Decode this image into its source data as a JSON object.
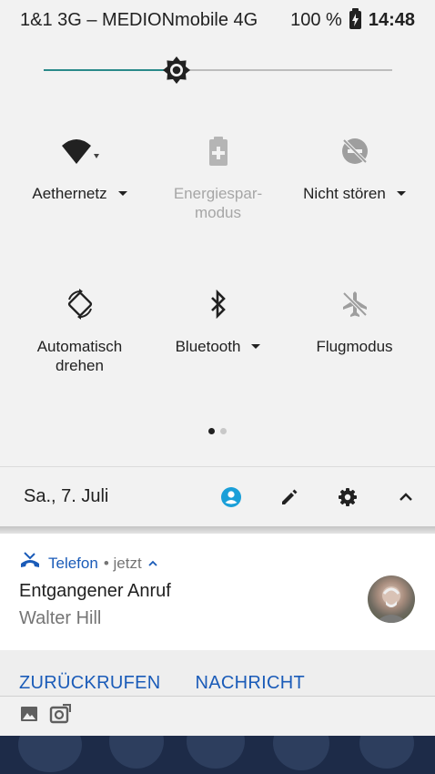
{
  "status_bar": {
    "carrier": "1&1 3G – MEDIONmobile 4G",
    "battery": "100 %",
    "time": "14:48"
  },
  "brightness": {
    "level_percent": 38
  },
  "quick_settings": [
    {
      "id": "wifi",
      "icon": "wifi-icon",
      "label": "Aethernetz",
      "dropdown": true,
      "enabled": true
    },
    {
      "id": "battery-saver",
      "icon": "battery-saver-icon",
      "label": "Energiespar-\nmodus",
      "dropdown": false,
      "enabled": false
    },
    {
      "id": "dnd",
      "icon": "do-not-disturb-icon",
      "label": "Nicht stören",
      "dropdown": true,
      "enabled": false
    },
    {
      "id": "autorotate",
      "icon": "rotate-icon",
      "label": "Automatisch\ndrehen",
      "dropdown": false,
      "enabled": true
    },
    {
      "id": "bluetooth",
      "icon": "bluetooth-icon",
      "label": "Bluetooth",
      "dropdown": true,
      "enabled": true
    },
    {
      "id": "airplane",
      "icon": "airplane-icon",
      "label": "Flugmodus",
      "dropdown": false,
      "enabled": false
    }
  ],
  "page_indicator": {
    "pages": 2,
    "active": 1
  },
  "footer": {
    "date": "Sa., 7. Juli",
    "icons": [
      "user-icon",
      "edit-icon",
      "settings-icon",
      "collapse-icon"
    ]
  },
  "notification": {
    "app": "Telefon",
    "time": "• jetzt",
    "title": "Entgangener Anruf",
    "text": "Walter Hill",
    "actions": [
      "ZURÜCKRUFEN",
      "NACHRICHT"
    ]
  },
  "colors": {
    "accent": "#2a8a8a",
    "link": "#1a5bb8",
    "profile": "#1a9fd8"
  }
}
